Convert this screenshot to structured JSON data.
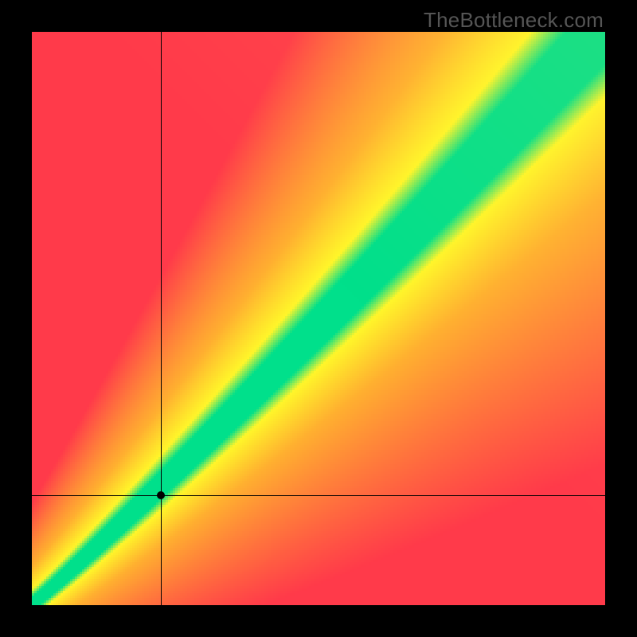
{
  "watermark": "TheBottleneck.com",
  "colors": {
    "optimal": "#00E08B",
    "good": "#FFF62A",
    "mid": "#FFB030",
    "poor": "#FF3A4A",
    "frame": "#000000"
  },
  "crosshair": {
    "x_frac": 0.225,
    "y_frac": 0.808
  },
  "chart_data": {
    "type": "heatmap",
    "title": "",
    "xlabel": "",
    "ylabel": "",
    "xlim": [
      0,
      1
    ],
    "ylim": [
      0,
      1
    ],
    "note": "Qualitative bottleneck heatmap; color encodes suitability along a diagonal optimal band. No numeric axis ticks are shown; values below are fractional positions in the plot.",
    "optimal_band": {
      "description": "Green band roughly follows y ≈ x with slight downward curvature near origin and slight upward trend toward top-right; band half-width grows from ~0.02 near origin to ~0.08 near top-right.",
      "samples": [
        {
          "x": 0.0,
          "y": 0.0,
          "half_width": 0.015
        },
        {
          "x": 0.1,
          "y": 0.085,
          "half_width": 0.02
        },
        {
          "x": 0.2,
          "y": 0.18,
          "half_width": 0.028
        },
        {
          "x": 0.3,
          "y": 0.28,
          "half_width": 0.034
        },
        {
          "x": 0.4,
          "y": 0.385,
          "half_width": 0.04
        },
        {
          "x": 0.5,
          "y": 0.495,
          "half_width": 0.048
        },
        {
          "x": 0.6,
          "y": 0.605,
          "half_width": 0.055
        },
        {
          "x": 0.7,
          "y": 0.715,
          "half_width": 0.062
        },
        {
          "x": 0.8,
          "y": 0.825,
          "half_width": 0.068
        },
        {
          "x": 0.9,
          "y": 0.93,
          "half_width": 0.075
        },
        {
          "x": 1.0,
          "y": 1.0,
          "half_width": 0.08
        }
      ]
    },
    "marker_point": {
      "x": 0.225,
      "y": 0.192
    }
  }
}
